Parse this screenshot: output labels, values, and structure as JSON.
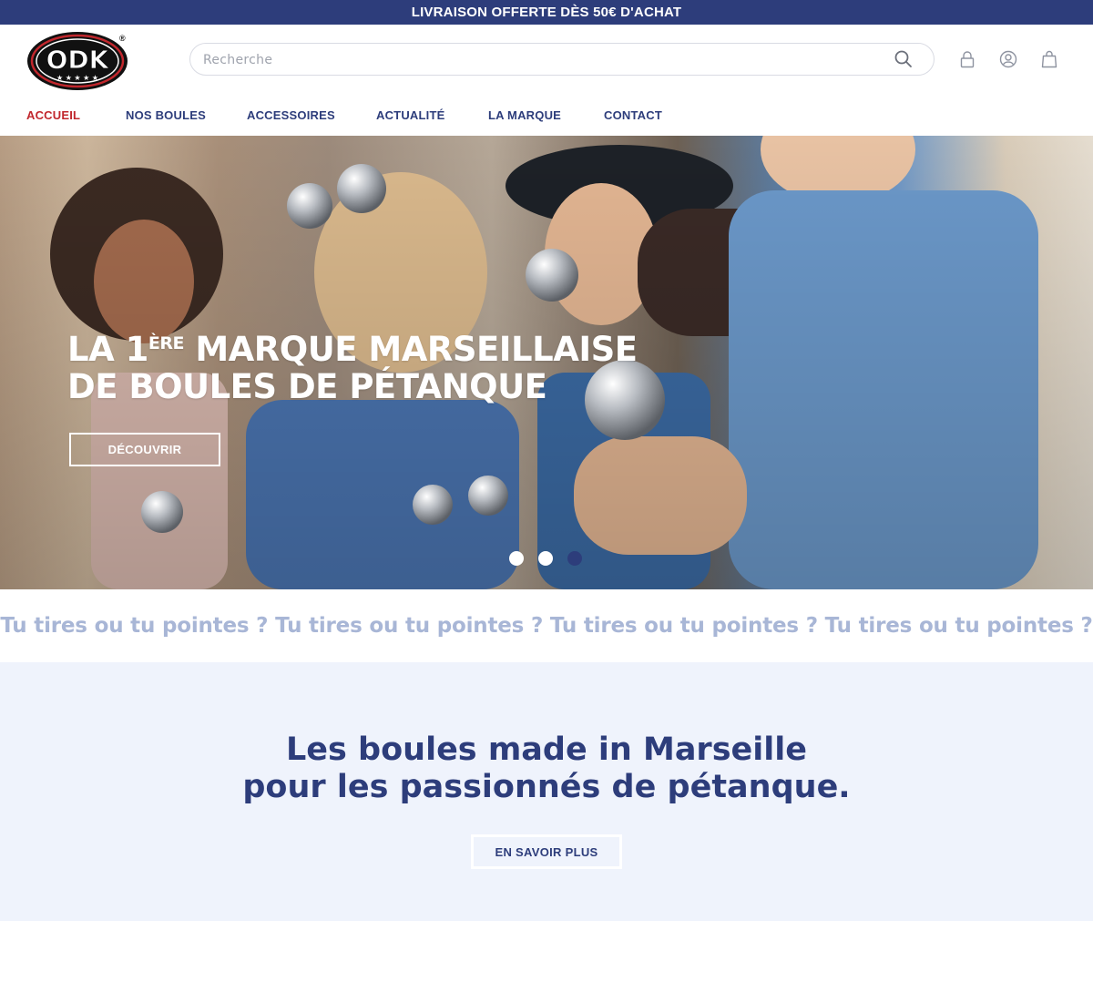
{
  "topbar": {
    "text": "LIVRAISON OFFERTE DÈS 50€ D'ACHAT"
  },
  "header": {
    "logo_text": "ODK",
    "logo_mark": "®",
    "search": {
      "placeholder": "Recherche",
      "value": ""
    },
    "icons": [
      "search-icon",
      "lock-icon",
      "user-account-icon",
      "shopping-bag-icon"
    ]
  },
  "nav": {
    "items": [
      {
        "label": "ACCUEIL",
        "active": true
      },
      {
        "label": "NOS BOULES",
        "active": false
      },
      {
        "label": "ACCESSOIRES",
        "active": false
      },
      {
        "label": "ACTUALITÉ",
        "active": false
      },
      {
        "label": "LA MARQUE",
        "active": false
      },
      {
        "label": "CONTACT",
        "active": false
      }
    ]
  },
  "hero": {
    "title_line1_prefix": "LA 1",
    "title_line1_sup": "ÈRE",
    "title_line1_suffix": " MARQUE MARSEILLAISE",
    "title_line2": "DE BOULES DE PÉTANQUE",
    "button_label": "DÉCOUVRIR",
    "slides_count": 3,
    "active_slide": 3
  },
  "marquee": {
    "text": "Tu tires ou tu pointes ? Tu tires ou tu pointes ? Tu tires ou tu pointes ? Tu tires ou tu pointes ?"
  },
  "promo": {
    "title_line1": "Les boules made in Marseille",
    "title_line2": "pour les passionnés de pétanque.",
    "button_label": "EN SAVOIR PLUS"
  },
  "colors": {
    "brand_blue": "#2d3d7b",
    "active_red": "#c1272d",
    "marquee_text": "#a8b6d6",
    "promo_background": "#eff3fc"
  }
}
